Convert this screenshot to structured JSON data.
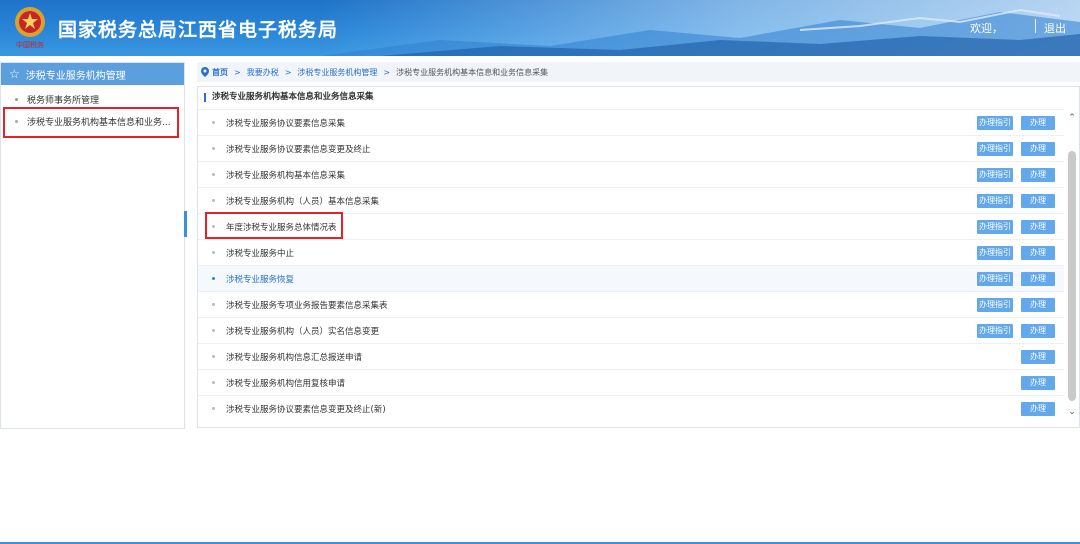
{
  "header": {
    "title": "国家税务总局江西省电子税务局",
    "logo_caption": "中国税务",
    "welcome": "欢迎，",
    "logout": "退出"
  },
  "sidebar": {
    "heading": "涉税专业服务机构管理",
    "items": [
      {
        "label": "税务师事务所管理"
      },
      {
        "label": "涉税专业服务机构基本信息和业务..."
      }
    ]
  },
  "breadcrumb": {
    "home": "首页",
    "separator": ">",
    "crumbs": [
      "我要办税",
      "涉税专业服务机构管理"
    ],
    "current": "涉税专业服务机构基本信息和业务信息采集"
  },
  "panel": {
    "title": "涉税专业服务机构基本信息和业务信息采集",
    "guide_label": "办理指引",
    "do_label": "办理",
    "rows": [
      {
        "label": "涉税专业服务协议要素信息采集"
      },
      {
        "label": "涉税专业服务协议要素信息变更及终止"
      },
      {
        "label": "涉税专业服务机构基本信息采集"
      },
      {
        "label": "涉税专业服务机构（人员）基本信息采集"
      },
      {
        "label": "年度涉税专业服务总体情况表"
      },
      {
        "label": "涉税专业服务中止"
      },
      {
        "label": "涉税专业服务恢复"
      },
      {
        "label": "涉税专业服务专项业务报告要素信息采集表"
      },
      {
        "label": "涉税专业服务机构（人员）实名信息变更"
      },
      {
        "label": "涉税专业服务机构信息汇总报送申请"
      },
      {
        "label": "涉税专业服务机构信用复核申请"
      },
      {
        "label": "涉税专业服务协议要素信息变更及终止(新)"
      }
    ]
  },
  "colors": {
    "header_blue": "#2a86d8",
    "accent_blue": "#2a6fcf",
    "button_blue": "#62a8ea",
    "highlight_red": "#e8202a"
  }
}
